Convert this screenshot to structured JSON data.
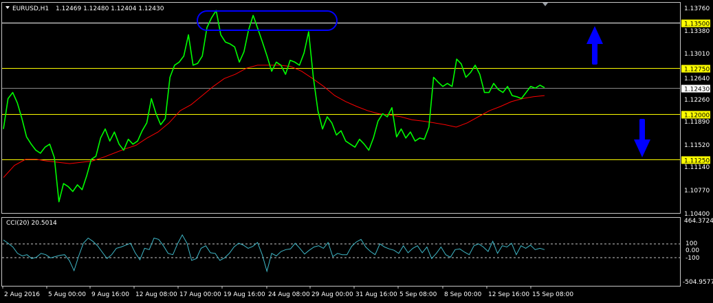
{
  "main_chart": {
    "symbol_label": "EURUSD,H1",
    "ohlc_label": "1.12469 1.12480 1.12404 1.12430",
    "price_ticks": [
      "1.13760",
      "1.13380",
      "1.13010",
      "1.12640",
      "1.12260",
      "1.11890",
      "1.11520",
      "1.11140",
      "1.10770",
      "1.10400"
    ],
    "levels": [
      {
        "value": 1.135,
        "label": "1.13500",
        "line_color": "#ffffff",
        "badge_color": "#ffff00"
      },
      {
        "value": 1.1275,
        "label": "1.12750",
        "line_color": "#ffff00",
        "badge_color": "#ffff00"
      },
      {
        "value": 1.12,
        "label": "1.12000",
        "line_color": "#ffff00",
        "badge_color": "#ffff00"
      },
      {
        "value": 1.1125,
        "label": "1.11250",
        "line_color": "#ffff00",
        "badge_color": "#ffff00"
      }
    ],
    "current_price": {
      "value": 1.1243,
      "label": "1.12430"
    }
  },
  "cci_panel": {
    "label": "CCI(20) 20.5014",
    "ticks": [
      "464.3724",
      "100",
      "0.00",
      "-100",
      "-504.9577"
    ]
  },
  "time_axis": {
    "labels": [
      "2 Aug 2016",
      "5 Aug 00:00",
      "9 Aug 16:00",
      "12 Aug 08:00",
      "17 Aug 00:00",
      "19 Aug 16:00",
      "24 Aug 08:00",
      "29 Aug 00:00",
      "31 Aug 16:00",
      "5 Sep 08:00",
      "8 Sep 00:00",
      "12 Sep 16:00",
      "15 Sep 08:00"
    ]
  },
  "colors": {
    "background": "#000000",
    "price_line": "#00ff00",
    "moving_average": "#ff0000",
    "cci_line": "#3fb8c8",
    "annotation": "#0000ff",
    "axis_text": "#ffffff"
  },
  "chart_data": [
    {
      "type": "line",
      "title": "EURUSD,H1",
      "ylim": [
        1.104,
        1.1376
      ],
      "series": [
        {
          "values": [
            1.1175,
            1.1225,
            1.1235,
            1.1218,
            1.1192,
            1.1162,
            1.115,
            1.114,
            1.1135,
            1.1145,
            1.115,
            1.1128,
            1.1055,
            1.1085,
            1.108,
            1.1072,
            1.1083,
            1.1075,
            1.1098,
            1.1125,
            1.113,
            1.116,
            1.1175,
            1.1155,
            1.117,
            1.115,
            1.114,
            1.1158,
            1.115,
            1.1155,
            1.1172,
            1.1185,
            1.1225,
            1.12,
            1.1182,
            1.1192,
            1.126,
            1.128,
            1.1285,
            1.1295,
            1.133,
            1.128,
            1.1283,
            1.1295,
            1.1342,
            1.1358,
            1.137,
            1.133,
            1.1318,
            1.1315,
            1.131,
            1.1285,
            1.1302,
            1.1338,
            1.1362,
            1.134,
            1.1318,
            1.1295,
            1.127,
            1.1285,
            1.128,
            1.1265,
            1.1288,
            1.1285,
            1.128,
            1.13,
            1.1335,
            1.126,
            1.1205,
            1.1175,
            1.1195,
            1.1185,
            1.1165,
            1.1172,
            1.1155,
            1.115,
            1.1145,
            1.1158,
            1.115,
            1.114,
            1.116,
            1.1188,
            1.12,
            1.1195,
            1.121,
            1.1162,
            1.1175,
            1.116,
            1.117,
            1.1155,
            1.116,
            1.1158,
            1.1178,
            1.126,
            1.1252,
            1.1245,
            1.125,
            1.1245,
            1.129,
            1.1282,
            1.126,
            1.1268,
            1.128,
            1.1265,
            1.1235,
            1.1235,
            1.125,
            1.124,
            1.1235,
            1.1245,
            1.123,
            1.1228,
            1.1225,
            1.1235,
            1.1245,
            1.1242,
            1.1247,
            1.1243
          ]
        },
        {
          "values": [
            1.1095,
            1.1115,
            1.1125,
            1.1125,
            1.1122,
            1.112,
            1.1118,
            1.112,
            1.1122,
            1.1128,
            1.1135,
            1.1142,
            1.1148,
            1.116,
            1.117,
            1.1185,
            1.1205,
            1.1215,
            1.123,
            1.1245,
            1.1258,
            1.1265,
            1.1275,
            1.128,
            1.128,
            1.128,
            1.1278,
            1.127,
            1.1258,
            1.1245,
            1.123,
            1.122,
            1.1212,
            1.1205,
            1.12,
            1.1198,
            1.1195,
            1.119,
            1.1188,
            1.1185,
            1.1182,
            1.1178,
            1.1185,
            1.1195,
            1.1205,
            1.1212,
            1.122,
            1.1225,
            1.1228,
            1.123
          ]
        }
      ]
    },
    {
      "type": "line",
      "title": "CCI(20) 20.5014",
      "ylim": [
        -504.9577,
        464.3724
      ],
      "series": [
        {
          "values": [
            170,
            120,
            60,
            -40,
            -80,
            -60,
            -120,
            -100,
            -40,
            -60,
            -110,
            -90,
            -70,
            -60,
            -150,
            -310,
            -80,
            120,
            200,
            150,
            80,
            -20,
            -120,
            -60,
            40,
            60,
            90,
            120,
            -30,
            -140,
            40,
            20,
            200,
            180,
            80,
            -40,
            -60,
            110,
            250,
            120,
            -150,
            -120,
            40,
            80,
            -30,
            -40,
            -150,
            -110,
            -40,
            60,
            120,
            90,
            40,
            70,
            130,
            -60,
            -320,
            -40,
            -80,
            -10,
            20,
            30,
            120,
            40,
            -50,
            10,
            60,
            80,
            40,
            130,
            -90,
            -40,
            -60,
            -60,
            70,
            140,
            180,
            60,
            -10,
            -60,
            110,
            60,
            30,
            10,
            -40,
            80,
            -30,
            40,
            80,
            -30,
            60,
            -120,
            -40,
            60,
            -60,
            -100,
            20,
            30,
            -20,
            -60,
            80,
            110,
            60,
            -10,
            150,
            -40,
            80,
            60,
            120,
            -60,
            80,
            40,
            90,
            20,
            40,
            20
          ]
        }
      ]
    }
  ]
}
